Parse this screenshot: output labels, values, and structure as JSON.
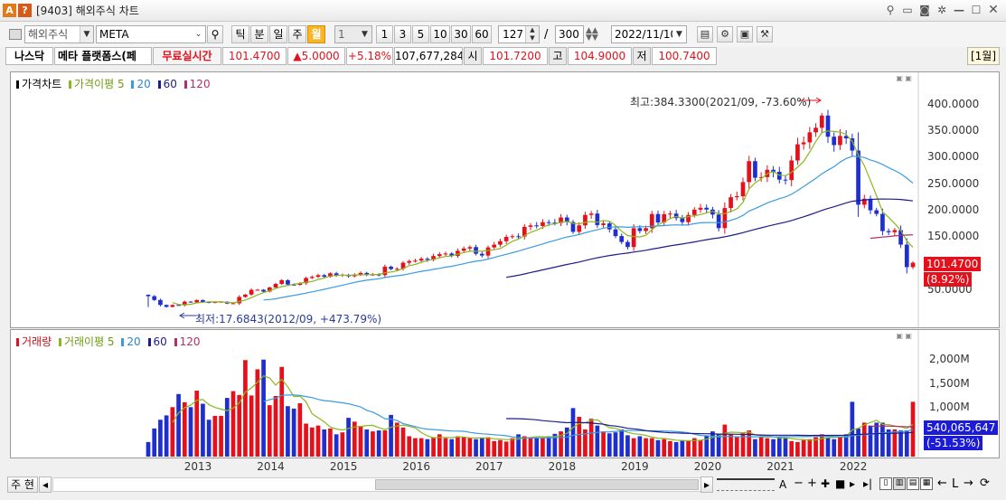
{
  "window": {
    "title": "[9403] 해외주식 차트",
    "badge_a": "A",
    "badge_q": "?",
    "controls": [
      "pin-icon",
      "screen-icon",
      "camera-icon",
      "gear-icon",
      "minimize-icon",
      "maximize-icon",
      "close-icon"
    ]
  },
  "toolbar": {
    "market_select": "해외주식",
    "symbol_input": "META",
    "period_buttons": [
      "틱",
      "분",
      "일",
      "주",
      "월"
    ],
    "active_period": "월",
    "interval_select": "1",
    "interval_buttons": [
      "1",
      "3",
      "5",
      "10",
      "30",
      "60"
    ],
    "count_input": "127",
    "slash": "/",
    "total_input": "300",
    "date_input": "2022/11/10"
  },
  "quote": {
    "exchange": "나스닥",
    "name": "메타 플랫폼스(페",
    "realtime": "무료실시간",
    "price": "101.4700",
    "change": "▲5.0000",
    "change_pct": "+5.18%",
    "volume": "107,677,284",
    "open_label": "시",
    "open": "101.7200",
    "high_label": "고",
    "high": "104.9000",
    "low_label": "저",
    "low": "100.7400",
    "period_badge": "[1월]"
  },
  "price_pane": {
    "legend_title": "가격차트",
    "legend_ma_label": "가격이평 5",
    "legend_ma": [
      "20",
      "60",
      "120"
    ],
    "high_annotation": "최고:384.3300(2021/09, -73.60%)",
    "low_annotation": "최저:17.6843(2012/09, +473.79%)",
    "current_price_tag": "101.4700",
    "current_pct_tag": "(8.92%)",
    "y_labels": [
      "400.0000",
      "350.0000",
      "300.0000",
      "250.0000",
      "200.0000",
      "150.0000",
      "100.0000",
      "50.0000"
    ]
  },
  "volume_pane": {
    "legend_title": "거래량",
    "legend_ma_label": "거래이평 5",
    "legend_ma": [
      "20",
      "60",
      "120"
    ],
    "y_labels": [
      "2,000M",
      "1,500M",
      "1,000M",
      "500M"
    ],
    "current_volume_tag": "540,065,647",
    "current_pct_tag": "(-51.53%)"
  },
  "x_labels": [
    "2013",
    "2014",
    "2015",
    "2016",
    "2017",
    "2018",
    "2019",
    "2020",
    "2021",
    "2022"
  ],
  "bottombar": {
    "main_label": "주 현",
    "left_arrow": "◂"
  },
  "colors": {
    "up": "#e4101b",
    "down": "#1f2fcf",
    "ma5": "#8ab81e",
    "ma20": "#3a9be0",
    "ma60": "#1c1c8c",
    "ma120": "#b0306a"
  },
  "chart_data": {
    "type": "candlestick",
    "interval": "monthly",
    "symbol": "META",
    "start": "2012/05",
    "end": "2022/11",
    "ylim": [
      0,
      420
    ],
    "closes": [
      38.23,
      31.1,
      21.71,
      18.06,
      21.66,
      21.11,
      28.0,
      26.62,
      30.98,
      27.25,
      25.58,
      27.43,
      27.77,
      24.35,
      24.88,
      36.8,
      41.29,
      50.23,
      50.39,
      47.01,
      54.65,
      61.48,
      68.46,
      60.24,
      59.78,
      62.82,
      72.65,
      74.82,
      77.95,
      74.99,
      81.45,
      77.09,
      78.66,
      75.91,
      78.97,
      82.22,
      78.77,
      79.19,
      78.04,
      94.01,
      89.43,
      89.9,
      101.47,
      104.66,
      105.41,
      108.99,
      106.93,
      114.1,
      117.58,
      118.81,
      114.28,
      123.94,
      128.27,
      130.99,
      118.42,
      115.05,
      130.32,
      135.54,
      142.05,
      150.25,
      151.46,
      150.98,
      169.25,
      171.97,
      170.87,
      178.0,
      177.18,
      176.46,
      186.89,
      178.32,
      159.79,
      172.0,
      191.78,
      194.32,
      172.58,
      175.73,
      164.46,
      151.79,
      140.61,
      131.09,
      166.69,
      161.45,
      166.69,
      193.4,
      177.47,
      193.0,
      194.23,
      185.67,
      178.08,
      191.65,
      201.64,
      205.25,
      201.91,
      192.47,
      166.8,
      204.71,
      225.09,
      227.07,
      253.67,
      293.2,
      261.9,
      263.11,
      276.97,
      273.16,
      258.33,
      257.62,
      294.53,
      325.08,
      328.73,
      347.71,
      356.3,
      379.38,
      339.39,
      323.57,
      340.89,
      336.35,
      313.26,
      211.03,
      222.36,
      200.47,
      193.64,
      161.25,
      159.1,
      163.0,
      135.68,
      93.16,
      101.47
    ],
    "price_high": 384.33,
    "price_high_date": "2021/09",
    "price_low": 17.6843,
    "price_low_date": "2012/09",
    "volume_unit": "M",
    "volume_ylim": [
      0,
      2200
    ],
    "volumes": [
      300,
      580,
      760,
      850,
      1020,
      1290,
      1120,
      1020,
      1360,
      1090,
      760,
      840,
      840,
      1210,
      1350,
      1270,
      1990,
      1260,
      1800,
      2000,
      1060,
      1250,
      1850,
      1040,
      990,
      1100,
      680,
      600,
      640,
      560,
      580,
      460,
      500,
      800,
      720,
      630,
      560,
      520,
      540,
      540,
      860,
      700,
      600,
      420,
      380,
      380,
      360,
      400,
      460,
      380,
      360,
      420,
      400,
      380,
      360,
      380,
      400,
      320,
      340,
      310,
      380,
      460,
      420,
      400,
      390,
      380,
      420,
      470,
      520,
      600,
      1000,
      820,
      560,
      780,
      640,
      520,
      480,
      500,
      560,
      440,
      380,
      420,
      380,
      380,
      340,
      360,
      320,
      300,
      340,
      320,
      380,
      340,
      420,
      520,
      460,
      660,
      460,
      400,
      480,
      540,
      360,
      400,
      380,
      360,
      420,
      380,
      320,
      300,
      340,
      360,
      400,
      460,
      400,
      360,
      400,
      460,
      1130,
      580,
      700,
      640,
      700,
      700,
      560,
      560,
      540,
      540,
      1130
    ]
  }
}
